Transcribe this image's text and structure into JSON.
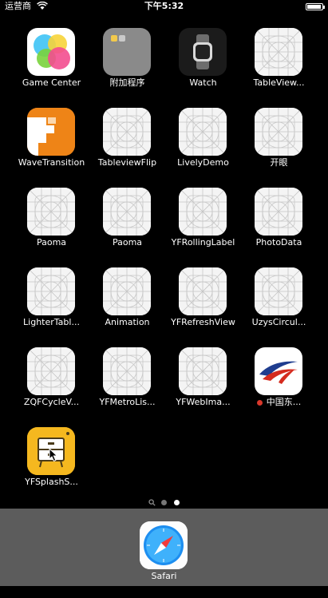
{
  "status_bar": {
    "carrier": "运营商",
    "time": "下午5:32"
  },
  "apps": [
    {
      "label": "Game Center",
      "icon": "game-center-icon"
    },
    {
      "label": "附加程序",
      "icon": "folder-icon"
    },
    {
      "label": "Watch",
      "icon": "watch-icon"
    },
    {
      "label": "TableView...",
      "icon": "placeholder-icon"
    },
    {
      "label": "WaveTransition",
      "icon": "wave-transition-icon"
    },
    {
      "label": "TableviewFlip",
      "icon": "placeholder-icon"
    },
    {
      "label": "LivelyDemo",
      "icon": "placeholder-icon"
    },
    {
      "label": "开眼",
      "icon": "placeholder-icon"
    },
    {
      "label": "Paoma",
      "icon": "placeholder-icon"
    },
    {
      "label": "Paoma",
      "icon": "placeholder-icon"
    },
    {
      "label": "YFRollingLabel",
      "icon": "placeholder-icon"
    },
    {
      "label": "PhotoData",
      "icon": "placeholder-icon"
    },
    {
      "label": "LighterTabl...",
      "icon": "placeholder-icon"
    },
    {
      "label": "Animation",
      "icon": "placeholder-icon"
    },
    {
      "label": "YFRefreshView",
      "icon": "placeholder-icon"
    },
    {
      "label": "UzysCircul...",
      "icon": "placeholder-icon"
    },
    {
      "label": "ZQFCycleV...",
      "icon": "placeholder-icon"
    },
    {
      "label": "YFMetroLis...",
      "icon": "placeholder-icon"
    },
    {
      "label": "YFWebIma...",
      "icon": "placeholder-icon"
    },
    {
      "label": "中国东...",
      "icon": "china-eastern-icon"
    },
    {
      "label": "YFSplashS...",
      "icon": "yf-splash-icon"
    }
  ],
  "dock": {
    "label": "Safari",
    "icon": "safari-icon"
  },
  "colors": {
    "background": "#000000",
    "dock": "#5c5c5c",
    "badge": "#d9382b"
  }
}
